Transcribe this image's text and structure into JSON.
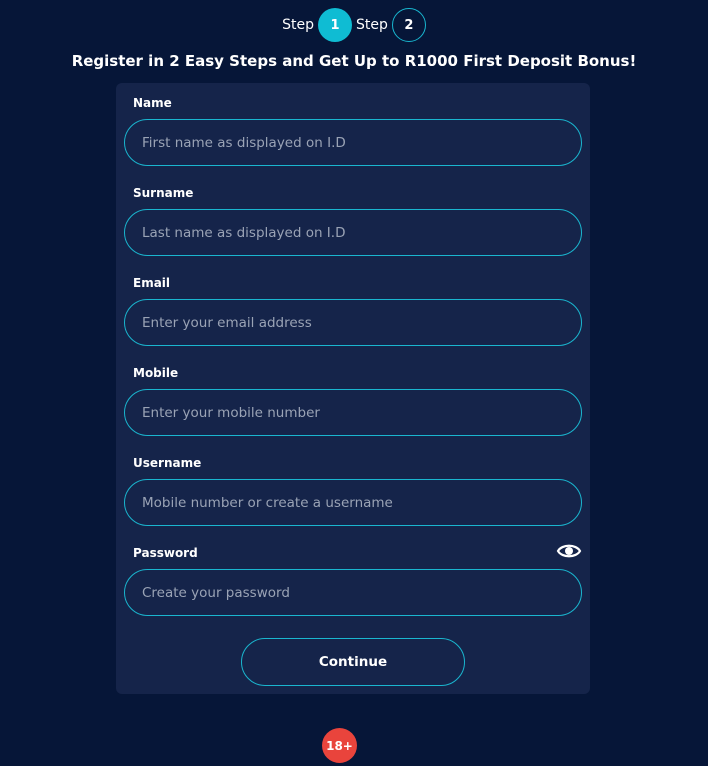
{
  "steps": {
    "step1": {
      "label": "Step",
      "number": "1",
      "active": true
    },
    "step2": {
      "label": "Step",
      "number": "2",
      "active": false
    }
  },
  "headline": "Register in 2 Easy Steps and Get Up to R1000 First Deposit Bonus!",
  "form": {
    "name": {
      "label": "Name",
      "placeholder": "First name as displayed on I.D",
      "value": ""
    },
    "surname": {
      "label": "Surname",
      "placeholder": "Last name as displayed on I.D",
      "value": ""
    },
    "email": {
      "label": "Email",
      "placeholder": "Enter your email address",
      "value": ""
    },
    "mobile": {
      "label": "Mobile",
      "placeholder": "Enter your mobile number",
      "value": ""
    },
    "username": {
      "label": "Username",
      "placeholder": "Mobile number or create a username",
      "value": ""
    },
    "password": {
      "label": "Password",
      "placeholder": "Create your password",
      "value": "",
      "toggle_icon": "eye-icon"
    },
    "continue_label": "Continue"
  },
  "age_badge": "18+",
  "colors": {
    "background": "#061638",
    "card": "#15244a",
    "accent": "#0fbcd3",
    "badge": "#e9443c"
  }
}
